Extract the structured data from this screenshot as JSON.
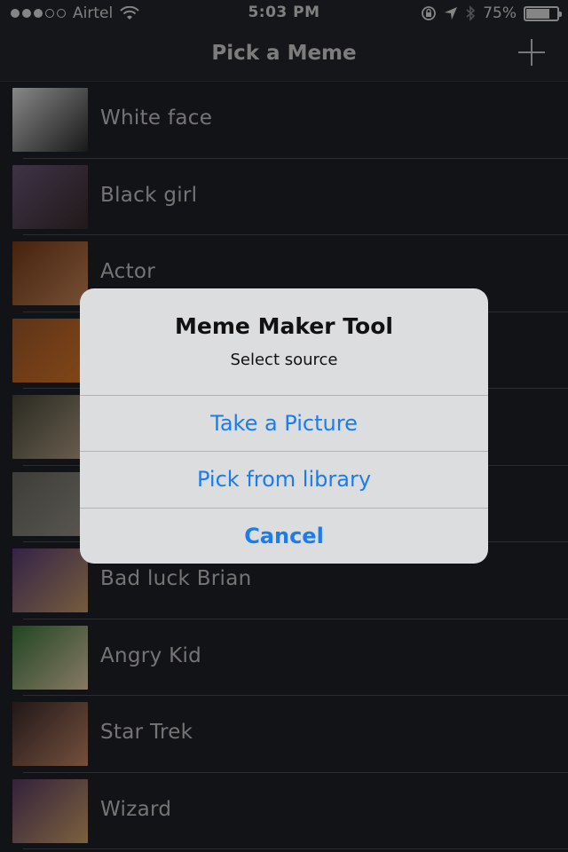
{
  "status_bar": {
    "carrier": "Airtel",
    "time": "5:03 PM",
    "battery": "75%",
    "battery_level": 0.75,
    "signal_bars_filled": 3,
    "signal_bars_total": 5
  },
  "nav": {
    "title": "Pick a Meme",
    "add_icon": "plus-icon"
  },
  "memes": [
    {
      "label": "White face",
      "thumb_colors": [
        "#e9e9e9",
        "#2b2b2b"
      ]
    },
    {
      "label": "Black girl",
      "thumb_colors": [
        "#6b5a7a",
        "#3a2b2b"
      ]
    },
    {
      "label": "Actor",
      "thumb_colors": [
        "#7a3b1a",
        "#c98a5a"
      ]
    },
    {
      "label": "",
      "thumb_colors": [
        "#a35a2a",
        "#e07a2a"
      ]
    },
    {
      "label": "",
      "thumb_colors": [
        "#4a4a3a",
        "#b8a58a"
      ]
    },
    {
      "label": "",
      "thumb_colors": [
        "#6a6a62",
        "#9a958a"
      ]
    },
    {
      "label": "Bad luck Brian",
      "thumb_colors": [
        "#5a3c7a",
        "#c9a06a"
      ]
    },
    {
      "label": "Angry Kid",
      "thumb_colors": [
        "#3a7a3a",
        "#e8d0b0"
      ]
    },
    {
      "label": "Star Trek",
      "thumb_colors": [
        "#3a2a2a",
        "#c98a6a"
      ]
    },
    {
      "label": "Wizard",
      "thumb_colors": [
        "#5a3a6a",
        "#d6a86a"
      ]
    }
  ],
  "alert": {
    "title": "Meme Maker Tool",
    "message": "Select source",
    "buttons": {
      "take_picture": "Take a Picture",
      "pick_library": "Pick from library",
      "cancel": "Cancel"
    }
  },
  "colors": {
    "accent": "#1a7cf0",
    "background": "#1f2126"
  }
}
